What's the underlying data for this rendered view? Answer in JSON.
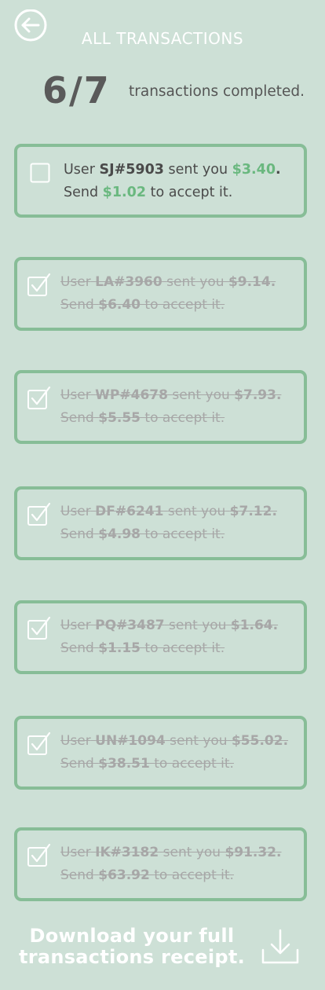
{
  "header": {
    "title": "ALL TRANSACTIONS",
    "back_icon": "arrow-left-circle-icon"
  },
  "summary": {
    "count": "6/7",
    "label": "transactions completed."
  },
  "transactions": [
    {
      "user": "SJ#5903",
      "received": "$3.40",
      "send": "$1.02",
      "completed": false
    },
    {
      "user": "LA#3960",
      "received": "$9.14",
      "send": "$6.40",
      "completed": true
    },
    {
      "user": "WP#4678",
      "received": "$7.93",
      "send": "$5.55",
      "completed": true
    },
    {
      "user": "DF#6241",
      "received": "$7.12",
      "send": "$4.98",
      "completed": true
    },
    {
      "user": "PQ#3487",
      "received": "$1.64",
      "send": "$1.15",
      "completed": true
    },
    {
      "user": "UN#1094",
      "received": "$55.02",
      "send": "$38.51",
      "completed": true
    },
    {
      "user": "IK#3182",
      "received": "$91.32",
      "send": "$63.92",
      "completed": true
    }
  ],
  "text": {
    "user_prefix": "User",
    "sent_you": "sent you",
    "send_prefix": "Send",
    "to_accept": "to accept it.",
    "period": "."
  },
  "footer": {
    "line1": "Download your full",
    "line2": "transactions receipt.",
    "icon": "download-icon"
  },
  "colors": {
    "background": "#cde0d6",
    "accent": "#87bd97",
    "amount": "#6ab87f"
  }
}
